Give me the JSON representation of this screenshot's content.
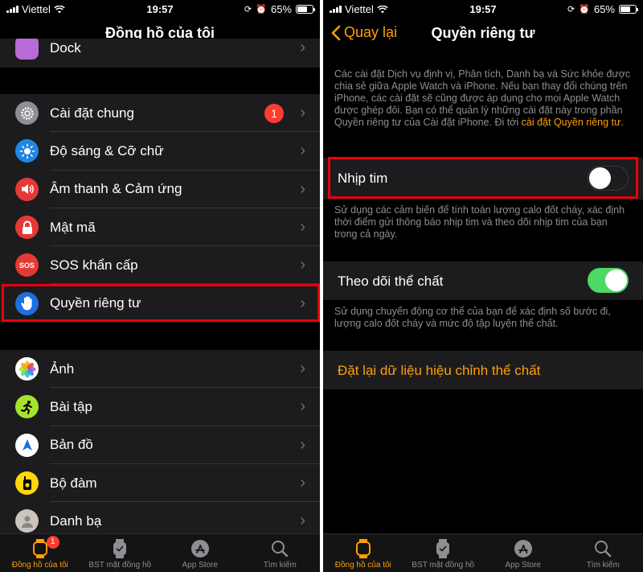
{
  "status": {
    "carrier": "Viettel",
    "time": "19:57",
    "battery": "65%"
  },
  "left": {
    "title": "Đồng hồ của tôi",
    "partial_item": "Dock",
    "group1": [
      {
        "label": "Cài đặt chung",
        "badge": "1"
      },
      {
        "label": "Độ sáng & Cỡ chữ"
      },
      {
        "label": "Âm thanh & Cảm ứng"
      },
      {
        "label": "Mật mã"
      },
      {
        "label": "SOS khẩn cấp",
        "icon_text": "SOS"
      },
      {
        "label": "Quyền riêng tư"
      }
    ],
    "group2": [
      {
        "label": "Ảnh"
      },
      {
        "label": "Bài tập"
      },
      {
        "label": "Bản đồ"
      },
      {
        "label": "Bộ đàm"
      },
      {
        "label": "Danh bạ"
      }
    ]
  },
  "right": {
    "back_label": "Quay lại",
    "title": "Quyền riêng tư",
    "intro": "Các cài đặt Dịch vụ định vị, Phân tích, Danh bạ và Sức khỏe được chia sẻ giữa Apple Watch và iPhone. Nếu bạn thay đổi chúng trên iPhone, các cài đặt sẽ cũng được áp dụng cho mọi Apple Watch được ghép đôi. Bạn có thể quản lý những cài đặt này trong phần Quyền riêng tư của Cài đặt iPhone. Đi tới ",
    "intro_link": "cài đặt Quyền riêng tư.",
    "heart_rate_label": "Nhịp tim",
    "heart_rate_on": false,
    "heart_rate_desc": "Sử dụng các cảm biến để tính toán lượng calo đốt cháy, xác định thời điểm gửi thông báo nhịp tim và theo dõi nhịp tim của bạn trong cả ngày.",
    "fitness_label": "Theo dõi thể chất",
    "fitness_on": true,
    "fitness_desc": "Sử dụng chuyển động cơ thể của bạn để xác định số bước đi, lượng calo đốt cháy và mức độ tập luyện thể chất.",
    "reset_label": "Đặt lại dữ liệu hiệu chỉnh thể chất"
  },
  "tabs": [
    {
      "label": "Đồng hồ của tôi",
      "badge": "1"
    },
    {
      "label": "BST mặt đồng hồ"
    },
    {
      "label": "App Store"
    },
    {
      "label": "Tìm kiếm"
    }
  ],
  "colors": {
    "accent": "#ff9f0a",
    "highlight": "#e8000b",
    "toggle_on": "#4cd964",
    "badge": "#ff3b30"
  }
}
